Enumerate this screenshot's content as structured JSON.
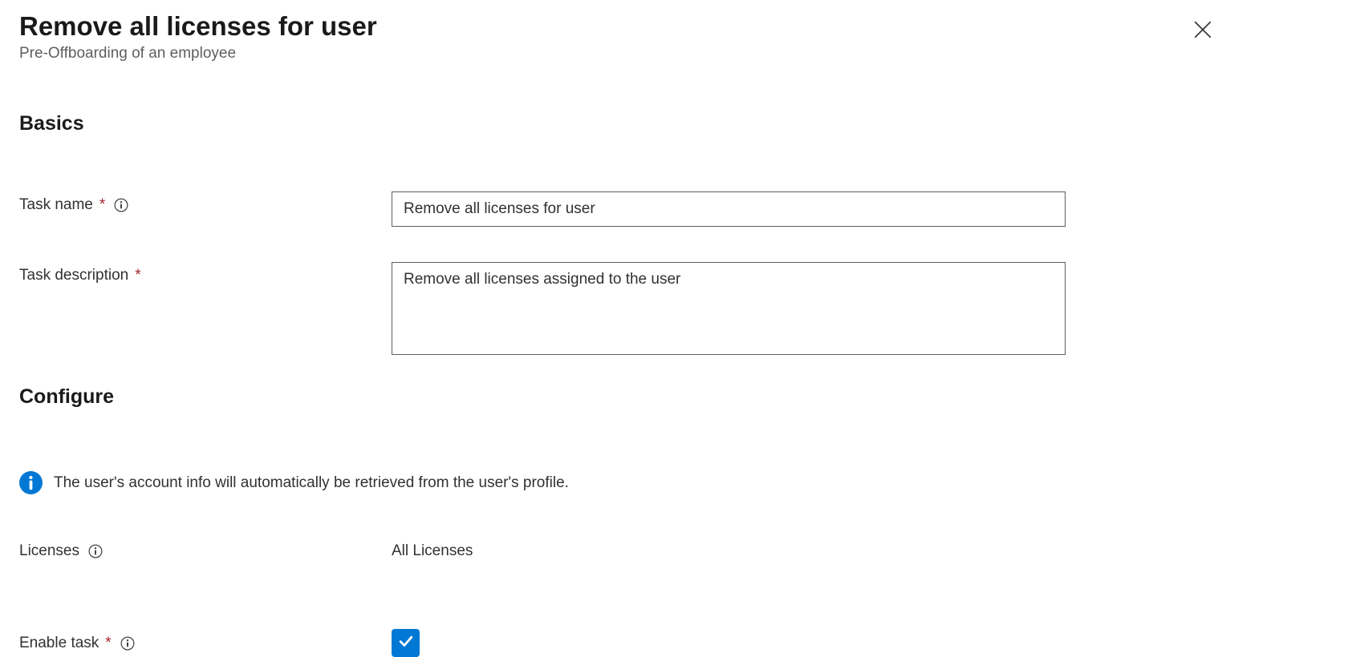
{
  "header": {
    "title": "Remove all licenses for user",
    "subtitle": "Pre-Offboarding of an employee"
  },
  "sections": {
    "basics": {
      "heading": "Basics",
      "task_name": {
        "label": "Task name",
        "value": "Remove all licenses for user"
      },
      "task_description": {
        "label": "Task description",
        "value": "Remove all licenses assigned to the user"
      }
    },
    "configure": {
      "heading": "Configure",
      "info_text": "The user's account info will automatically be retrieved from the user's profile.",
      "licenses": {
        "label": "Licenses",
        "value": "All Licenses"
      },
      "enable_task": {
        "label": "Enable task",
        "checked": true
      }
    }
  }
}
